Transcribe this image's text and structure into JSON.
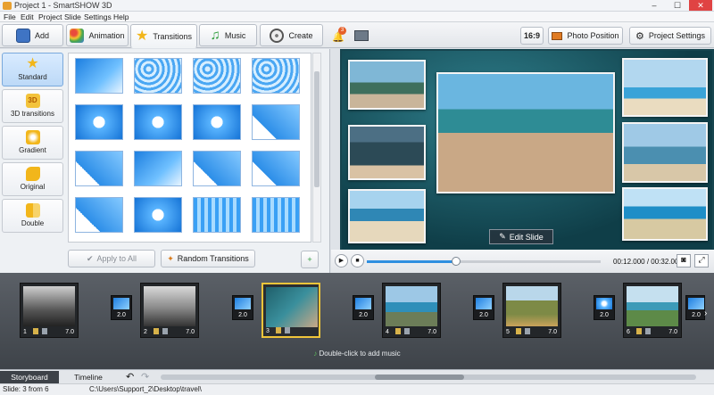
{
  "window": {
    "title": "Project 1 - SmartSHOW 3D",
    "controls": [
      "–",
      "☐",
      "✕"
    ]
  },
  "menu": [
    "File",
    "Edit",
    "Project",
    "Slide",
    "Settings",
    "Help"
  ],
  "toolbar": {
    "tabs": [
      {
        "label": "Add",
        "icon": "photo-add-icon"
      },
      {
        "label": "Animation",
        "icon": "palette-icon"
      },
      {
        "label": "Transitions",
        "icon": "star-icon",
        "active": true
      },
      {
        "label": "Music",
        "icon": "music-note-icon"
      },
      {
        "label": "Create",
        "icon": "film-reel-icon"
      }
    ],
    "notification_count": "3",
    "aspect_label": "16:9",
    "photo_position_label": "Photo Position",
    "project_settings_label": "Project Settings"
  },
  "transitions": {
    "categories": [
      {
        "label": "Standard",
        "icon": "star-icon",
        "selected": true
      },
      {
        "label": "3D transitions",
        "icon": "3d-icon"
      },
      {
        "label": "Gradient",
        "icon": "gradient-icon"
      },
      {
        "label": "Original",
        "icon": "puzzle-icon"
      },
      {
        "label": "Double",
        "icon": "double-icon"
      }
    ],
    "apply_all_label": "Apply to All",
    "random_label": "Random Transitions"
  },
  "preview": {
    "edit_slide_label": "Edit Slide",
    "timecode": "00:12.000 / 00:32.000"
  },
  "storyboard": {
    "slides": [
      {
        "num": "1",
        "duration": "7.0"
      },
      {
        "num": "2",
        "duration": "7.0"
      },
      {
        "num": "3",
        "duration": "",
        "selected": true
      },
      {
        "num": "4",
        "duration": "7.0"
      },
      {
        "num": "5",
        "duration": "7.0"
      },
      {
        "num": "6",
        "duration": "7.0"
      }
    ],
    "transitions": [
      "2.0",
      "2.0",
      "2.0",
      "2.0",
      "2.0",
      "2.0"
    ],
    "audio_hint": "Double-click to add music"
  },
  "tabs_bottom": [
    "Storyboard",
    "Timeline"
  ],
  "status": {
    "slide_info": "Slide: 3 from 6",
    "path": "C:\\Users\\Support_2\\Desktop\\travel\\"
  }
}
